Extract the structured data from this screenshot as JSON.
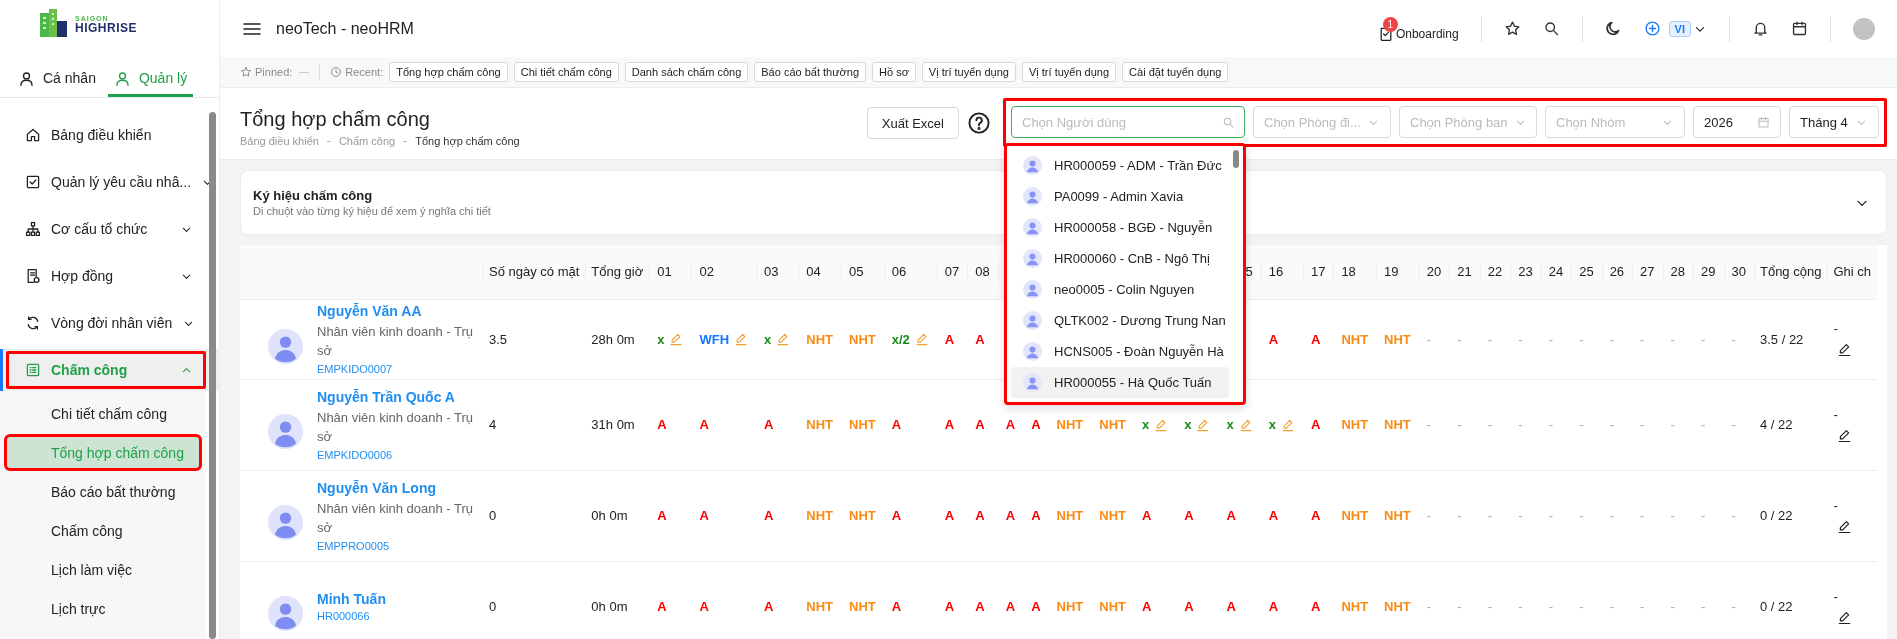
{
  "sidebar": {
    "logo": {
      "top": "SAIGON",
      "bottom": "HIGHRISE"
    },
    "role_tabs": [
      {
        "label": "Cá nhân",
        "selected": false
      },
      {
        "label": "Quản lý",
        "selected": true
      }
    ],
    "items": [
      {
        "label": "Bảng điều khiển",
        "selected": false,
        "highlighted": false
      },
      {
        "label": "Quản lý yêu cầu nhâ...",
        "expanded": false,
        "selected": false,
        "highlighted": false
      },
      {
        "label": "Cơ cấu tổ chức",
        "expanded": false,
        "selected": false,
        "highlighted": false
      },
      {
        "label": "Hợp đồng",
        "expanded": false,
        "selected": false,
        "highlighted": false
      },
      {
        "label": "Vòng đời nhân viên",
        "expanded": false,
        "selected": false,
        "highlighted": false
      },
      {
        "label": "Chấm công",
        "expanded": true,
        "selected": true,
        "highlighted": true,
        "children": [
          {
            "label": "Chi tiết chấm công",
            "selected": false,
            "highlighted": false
          },
          {
            "label": "Tổng hợp chấm công",
            "selected": true,
            "highlighted": true
          },
          {
            "label": "Báo cáo bất thường",
            "selected": false,
            "highlighted": false
          },
          {
            "label": "Chấm công",
            "selected": false,
            "highlighted": false
          },
          {
            "label": "Lịch làm việc",
            "selected": false,
            "highlighted": false
          },
          {
            "label": "Lịch trực",
            "selected": false,
            "highlighted": false
          }
        ]
      }
    ]
  },
  "topbar": {
    "title": "neoTech - neoHRM",
    "onboarding": {
      "label": "Onboarding",
      "badge": "1"
    },
    "language": "VI"
  },
  "quick_bar": {
    "pinned_label": "Pinned:",
    "recent_label": "Recent:",
    "recent": [
      "Tổng hợp chấm công",
      "Chi tiết chấm công",
      "Danh sách chấm công",
      "Báo cáo bất thường",
      "Hồ sơ",
      "Vị trí tuyển dụng",
      "Vị trí tuyển dụng",
      "Cài đặt tuyển dụng"
    ]
  },
  "page": {
    "title": "Tổng hợp chấm công",
    "breadcrumb": [
      "Bảng điều khiển",
      "Chấm công",
      "Tổng hợp chấm công"
    ],
    "export_button": "Xuất Excel"
  },
  "filters": {
    "highlighted": true,
    "items": [
      {
        "kind": "search",
        "placeholder": "Chọn Người dùng",
        "focused": true
      },
      {
        "kind": "select",
        "placeholder": "Chọn Phòng đi..."
      },
      {
        "kind": "select",
        "placeholder": "Chọn Phòng ban"
      },
      {
        "kind": "select",
        "placeholder": "Chọn Nhóm"
      },
      {
        "kind": "date",
        "value": "2026"
      },
      {
        "kind": "select",
        "value": "Tháng 4"
      }
    ]
  },
  "user_dropdown": {
    "highlighted": true,
    "options": [
      {
        "label": "HR000059 - ADM - Trần Đức",
        "hovered": false
      },
      {
        "label": "PA0099 - Admin Xavia",
        "hovered": false
      },
      {
        "label": "HR000058 - BGĐ - Nguyễn",
        "hovered": false
      },
      {
        "label": "HR000060 - CnB - Ngô Thị",
        "hovered": false
      },
      {
        "label": "neo0005 - Colin Nguyen",
        "hovered": false
      },
      {
        "label": "QLTK002 - Dương Trung Nan",
        "hovered": false
      },
      {
        "label": "HCNS005 - Đoàn Nguyễn Hà",
        "hovered": false
      },
      {
        "label": "HR000055 - Hà Quốc Tuấn",
        "hovered": true
      }
    ]
  },
  "legend": {
    "title": "Ký hiệu chấm công",
    "subtitle": "Di chuột vào từng ký hiệu để xem ý nghĩa chi tiết",
    "expanded": false
  },
  "table": {
    "columns": [
      "Số ngày có mặt",
      "Tổng giờ",
      "01",
      "02",
      "03",
      "04",
      "05",
      "06",
      "07",
      "08"
    ],
    "columns_right": [
      {
        "label": "5"
      },
      {
        "label": "16"
      },
      {
        "label": "17"
      },
      {
        "label": "18"
      },
      {
        "label": "19"
      },
      {
        "label": "20"
      },
      {
        "label": "21"
      },
      {
        "label": "22"
      },
      {
        "label": "23"
      },
      {
        "label": "24"
      },
      {
        "label": "25"
      },
      {
        "label": "26"
      },
      {
        "label": "27"
      },
      {
        "label": "28"
      },
      {
        "label": "29"
      },
      {
        "label": "30"
      },
      {
        "label": "Tổng cộng"
      },
      {
        "label": "Ghi ch"
      }
    ],
    "rows": [
      {
        "name": "Nguyễn Văn AA",
        "position": "Nhân viên kinh doanh - Trụ sở",
        "code": "EMPKIDO0007",
        "present_days": "3.5",
        "total_hours": "28h 0m",
        "total": "3.5 / 22",
        "note": "-",
        "days": [
          {
            "value": "x",
            "kind": "present",
            "editable": true
          },
          {
            "value": "WFH",
            "kind": "wfh",
            "editable": true
          },
          {
            "value": "x",
            "kind": "present",
            "editable": true
          },
          {
            "value": "NHT",
            "kind": "holiday"
          },
          {
            "value": "NHT",
            "kind": "holiday"
          },
          {
            "value": "x/2",
            "kind": "present",
            "editable": true
          },
          {
            "value": "A",
            "kind": "absent"
          },
          {
            "value": "A",
            "kind": "absent"
          }
        ],
        "days_right": [
          {
            "value": "A",
            "kind": "absent"
          },
          {
            "value": "A",
            "kind": "absent"
          },
          {
            "value": "NHT",
            "kind": "holiday"
          },
          {
            "value": "NHT",
            "kind": "holiday"
          },
          {
            "value": "-",
            "kind": "empty"
          },
          {
            "value": "-",
            "kind": "empty"
          },
          {
            "value": "-",
            "kind": "empty"
          },
          {
            "value": "-",
            "kind": "empty"
          },
          {
            "value": "-",
            "kind": "empty"
          },
          {
            "value": "-",
            "kind": "empty"
          },
          {
            "value": "-",
            "kind": "empty"
          },
          {
            "value": "-",
            "kind": "empty"
          },
          {
            "value": "-",
            "kind": "empty"
          },
          {
            "value": "-",
            "kind": "empty"
          },
          {
            "value": "-",
            "kind": "empty"
          }
        ]
      },
      {
        "name": "Nguyễn Trần Quốc A",
        "position": "Nhân viên kinh doanh - Trụ sở",
        "code": "EMPKIDO0006",
        "present_days": "4",
        "total_hours": "31h 0m",
        "total": "4 / 22",
        "note": "-",
        "days": [
          {
            "value": "A",
            "kind": "absent"
          },
          {
            "value": "A",
            "kind": "absent"
          },
          {
            "value": "A",
            "kind": "absent"
          },
          {
            "value": "NHT",
            "kind": "holiday"
          },
          {
            "value": "NHT",
            "kind": "holiday"
          },
          {
            "value": "A",
            "kind": "absent"
          },
          {
            "value": "A",
            "kind": "absent"
          },
          {
            "value": "A",
            "kind": "absent"
          },
          {
            "value": "A",
            "kind": "absent"
          },
          {
            "value": "A",
            "kind": "absent"
          },
          {
            "value": "NHT",
            "kind": "holiday"
          },
          {
            "value": "NHT",
            "kind": "holiday"
          },
          {
            "value": "x",
            "kind": "present",
            "editable": true
          },
          {
            "value": "x",
            "kind": "present",
            "editable": true
          },
          {
            "value": "x",
            "kind": "present",
            "editable": true
          },
          {
            "value": "x",
            "kind": "present",
            "editable": true
          },
          {
            "value": "A",
            "kind": "absent"
          },
          {
            "value": "NHT",
            "kind": "holiday"
          },
          {
            "value": "NHT",
            "kind": "holiday"
          },
          {
            "value": "-",
            "kind": "empty"
          },
          {
            "value": "-",
            "kind": "empty"
          },
          {
            "value": "-",
            "kind": "empty"
          },
          {
            "value": "-",
            "kind": "empty"
          },
          {
            "value": "-",
            "kind": "empty"
          },
          {
            "value": "-",
            "kind": "empty"
          },
          {
            "value": "-",
            "kind": "empty"
          },
          {
            "value": "-",
            "kind": "empty"
          },
          {
            "value": "-",
            "kind": "empty"
          },
          {
            "value": "-",
            "kind": "empty"
          },
          {
            "value": "-",
            "kind": "empty"
          }
        ]
      },
      {
        "name": "Nguyễn Văn Long",
        "position": "Nhân viên kinh doanh - Trụ sở",
        "code": "EMPPRO0005",
        "present_days": "0",
        "total_hours": "0h 0m",
        "total": "0 / 22",
        "note": "-",
        "days": [
          {
            "value": "A",
            "kind": "absent"
          },
          {
            "value": "A",
            "kind": "absent"
          },
          {
            "value": "A",
            "kind": "absent"
          },
          {
            "value": "NHT",
            "kind": "holiday"
          },
          {
            "value": "NHT",
            "kind": "holiday"
          },
          {
            "value": "A",
            "kind": "absent"
          },
          {
            "value": "A",
            "kind": "absent"
          },
          {
            "value": "A",
            "kind": "absent"
          },
          {
            "value": "A",
            "kind": "absent"
          },
          {
            "value": "A",
            "kind": "absent"
          },
          {
            "value": "NHT",
            "kind": "holiday"
          },
          {
            "value": "NHT",
            "kind": "holiday"
          },
          {
            "value": "A",
            "kind": "absent"
          },
          {
            "value": "A",
            "kind": "absent"
          },
          {
            "value": "A",
            "kind": "absent"
          },
          {
            "value": "A",
            "kind": "absent"
          },
          {
            "value": "A",
            "kind": "absent"
          },
          {
            "value": "NHT",
            "kind": "holiday"
          },
          {
            "value": "NHT",
            "kind": "holiday"
          },
          {
            "value": "-",
            "kind": "empty"
          },
          {
            "value": "-",
            "kind": "empty"
          },
          {
            "value": "-",
            "kind": "empty"
          },
          {
            "value": "-",
            "kind": "empty"
          },
          {
            "value": "-",
            "kind": "empty"
          },
          {
            "value": "-",
            "kind": "empty"
          },
          {
            "value": "-",
            "kind": "empty"
          },
          {
            "value": "-",
            "kind": "empty"
          },
          {
            "value": "-",
            "kind": "empty"
          },
          {
            "value": "-",
            "kind": "empty"
          },
          {
            "value": "-",
            "kind": "empty"
          }
        ]
      },
      {
        "name": "Minh Tuấn",
        "code": "HR000066",
        "present_days": "0",
        "total_hours": "0h 0m",
        "total": "0 / 22",
        "note": "-",
        "days": [
          {
            "value": "A",
            "kind": "absent"
          },
          {
            "value": "A",
            "kind": "absent"
          },
          {
            "value": "A",
            "kind": "absent"
          },
          {
            "value": "NHT",
            "kind": "holiday"
          },
          {
            "value": "NHT",
            "kind": "holiday"
          },
          {
            "value": "A",
            "kind": "absent"
          },
          {
            "value": "A",
            "kind": "absent"
          },
          {
            "value": "A",
            "kind": "absent"
          },
          {
            "value": "A",
            "kind": "absent"
          },
          {
            "value": "A",
            "kind": "absent"
          },
          {
            "value": "NHT",
            "kind": "holiday"
          },
          {
            "value": "NHT",
            "kind": "holiday"
          },
          {
            "value": "A",
            "kind": "absent"
          },
          {
            "value": "A",
            "kind": "absent"
          },
          {
            "value": "A",
            "kind": "absent"
          },
          {
            "value": "A",
            "kind": "absent"
          },
          {
            "value": "A",
            "kind": "absent"
          },
          {
            "value": "NHT",
            "kind": "holiday"
          },
          {
            "value": "NHT",
            "kind": "holiday"
          },
          {
            "value": "-",
            "kind": "empty"
          },
          {
            "value": "-",
            "kind": "empty"
          },
          {
            "value": "-",
            "kind": "empty"
          },
          {
            "value": "-",
            "kind": "empty"
          },
          {
            "value": "-",
            "kind": "empty"
          },
          {
            "value": "-",
            "kind": "empty"
          },
          {
            "value": "-",
            "kind": "empty"
          },
          {
            "value": "-",
            "kind": "empty"
          },
          {
            "value": "-",
            "kind": "empty"
          },
          {
            "value": "-",
            "kind": "empty"
          },
          {
            "value": "-",
            "kind": "empty"
          }
        ]
      }
    ]
  }
}
